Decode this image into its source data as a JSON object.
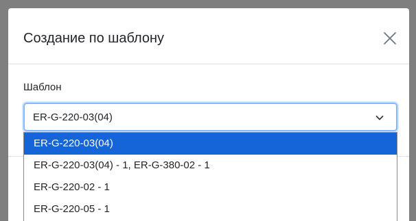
{
  "dialog": {
    "title": "Создание по шаблону",
    "close_icon": "close-icon"
  },
  "form": {
    "label": "Шаблон",
    "selected_value": "ER-G-220-03(04)",
    "chevron_icon": "chevron-down-icon"
  },
  "dropdown": {
    "options": [
      {
        "label": "ER-G-220-03(04)",
        "selected": true
      },
      {
        "label": "ER-G-220-03(04) - 1, ER-G-380-02 - 1",
        "selected": false
      },
      {
        "label": "ER-G-220-02 - 1",
        "selected": false
      },
      {
        "label": "ER-G-220-05 - 1",
        "selected": false
      }
    ]
  },
  "colors": {
    "backdrop": "#7f7f7f",
    "highlight": "#1565d8",
    "focus_border": "#86b7fe"
  }
}
